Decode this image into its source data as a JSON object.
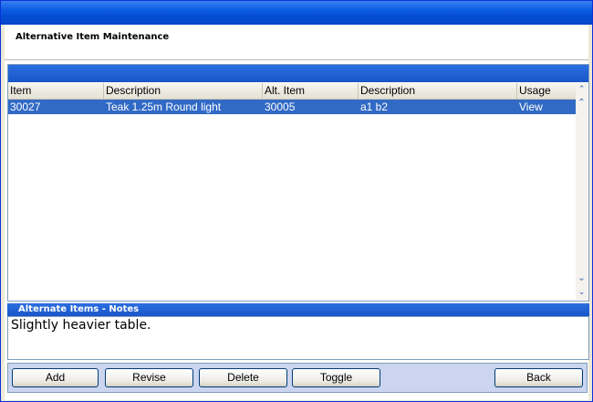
{
  "header": {
    "title": "Alternative Item Maintenance"
  },
  "table": {
    "columns": [
      "Item",
      "Description",
      "Alt. Item",
      "Description",
      "Usage"
    ],
    "rows": [
      {
        "item": "30027",
        "description": "Teak 1.25m Round light",
        "alt_item": "30005",
        "alt_description": "a1 b2",
        "usage": "View"
      }
    ]
  },
  "notes": {
    "title": "Alternate Items - Notes",
    "text": "Slightly heavier table."
  },
  "buttons": {
    "add": "Add",
    "revise": "Revise",
    "delete": "Delete",
    "toggle": "Toggle",
    "back": "Back"
  },
  "colors": {
    "titlebar": "#0a5ae0",
    "selection": "#316ac5",
    "panel_header": "#1a56c8",
    "button_bar": "#cbd5f0"
  },
  "icons": {
    "scroll_up": "chevron-up-icon",
    "scroll_page_up": "double-chevron-up-icon",
    "scroll_page_down": "double-chevron-down-icon",
    "scroll_down": "chevron-down-icon"
  }
}
